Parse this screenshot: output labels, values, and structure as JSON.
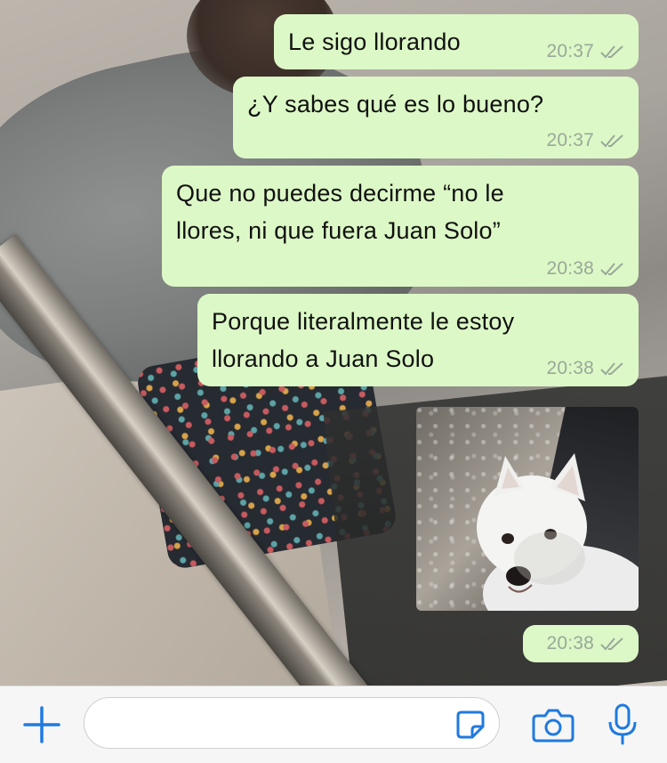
{
  "messages": [
    {
      "text": "Le sigo llorando",
      "time": "20:37"
    },
    {
      "text": "¿Y sabes qué es lo bueno?",
      "time": "20:37"
    },
    {
      "text": "Que no puedes decirme “no le\nllores, ni que fuera Juan Solo”",
      "time": "20:38"
    },
    {
      "text": "Porque literalmente le estoy\nllorando a Juan Solo",
      "time": "20:38"
    },
    {
      "type": "image",
      "time": "20:38"
    }
  ],
  "composer": {
    "placeholder": ""
  },
  "colors": {
    "outgoing_bubble": "#dcf8c6",
    "accent": "#1f7ae0",
    "ticks": "#9aa89a"
  },
  "icons": [
    "plus-icon",
    "sticker-icon",
    "camera-icon",
    "microphone-icon",
    "double-check-icon"
  ]
}
